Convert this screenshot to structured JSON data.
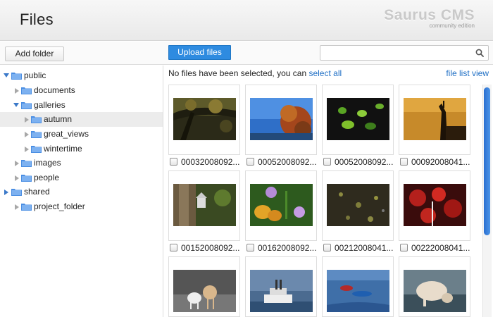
{
  "header": {
    "title": "Files",
    "brand_name": "Saurus CMS",
    "brand_sub": "community edition"
  },
  "toolbar": {
    "add_folder_label": "Add folder",
    "upload_label": "Upload files",
    "search_value": "",
    "search_icon": "magnifier-icon"
  },
  "tree": {
    "nodes": [
      {
        "label": "public",
        "expanded": true
      },
      {
        "label": "documents",
        "expanded": false
      },
      {
        "label": "galleries",
        "expanded": true
      },
      {
        "label": "autumn",
        "selected": true
      },
      {
        "label": "great_views"
      },
      {
        "label": "wintertime"
      },
      {
        "label": "images"
      },
      {
        "label": "people"
      },
      {
        "label": "shared",
        "expanded": false
      },
      {
        "label": "project_folder"
      }
    ]
  },
  "main": {
    "status_prefix": "No files have been selected, you can",
    "select_all_label": "select all",
    "list_view_label": "file list view"
  },
  "files": [
    {
      "name": "00032008092...",
      "image": "tree-branches-autumn"
    },
    {
      "name": "00052008092...",
      "image": "autumn-tree-blue-sky"
    },
    {
      "name": "00052008092...",
      "image": "green-leaves-dark"
    },
    {
      "name": "00092008041...",
      "image": "statue-silhouette-sunset"
    },
    {
      "name": "00152008092...",
      "image": "birdhouse-on-trunk"
    },
    {
      "name": "00162008092...",
      "image": "purple-flowers"
    },
    {
      "name": "00212008041...",
      "image": "lichen-ground"
    },
    {
      "name": "00222008041...",
      "image": "red-leaves"
    },
    {
      "name": "",
      "image": "two-dogs"
    },
    {
      "name": "",
      "image": "steamboat"
    },
    {
      "name": "",
      "image": "boats-water"
    },
    {
      "name": "",
      "image": "dog-drinking"
    }
  ],
  "colors": {
    "accent": "#2e8be0",
    "link": "#1f6fc5",
    "tree_arrow": "#3b79c9",
    "folder": "#4a8ee3"
  }
}
